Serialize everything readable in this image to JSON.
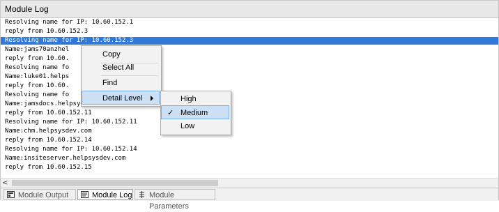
{
  "panel": {
    "title": "Module Log"
  },
  "log": {
    "lines": [
      "Resolving name for IP: 10.60.152.1",
      "reply from 10.60.152.3",
      "Resolving name for IP: 10.60.152.3",
      "Name:jams70anzhel",
      "reply from 10.60.",
      "Resolving name fo",
      "Name:luke01.helps",
      "reply from 10.60.",
      "Resolving name fo",
      "Name:jamsdocs.helpsysdev.com",
      "reply from 10.60.152.11",
      "Resolving name for IP: 10.60.152.11",
      "Name:chm.helpsysdev.com",
      "reply from 10.60.152.14",
      "Resolving name for IP: 10.60.152.14",
      "Name:insiteserver.helpsysdev.com",
      "reply from 10.60.152.15"
    ],
    "selected_index": 2
  },
  "scrollbar": {
    "left_arrow": "<"
  },
  "tabs": [
    {
      "label": "Module Output",
      "icon": "module-output-icon",
      "active": false
    },
    {
      "label": "Module Log",
      "icon": "module-log-icon",
      "active": true
    },
    {
      "label": "Module Parameters",
      "icon": "module-parameters-icon",
      "active": false
    }
  ],
  "context_menu": {
    "copy": "Copy",
    "select_all": "Select All",
    "find": "Find",
    "detail_level": "Detail Level"
  },
  "submenu": {
    "high": "High",
    "medium": "Medium",
    "low": "Low",
    "checked": "Medium",
    "check_glyph": "✓"
  },
  "colors": {
    "selection": "#3079d8",
    "menu_hover": "#cce0f5"
  }
}
